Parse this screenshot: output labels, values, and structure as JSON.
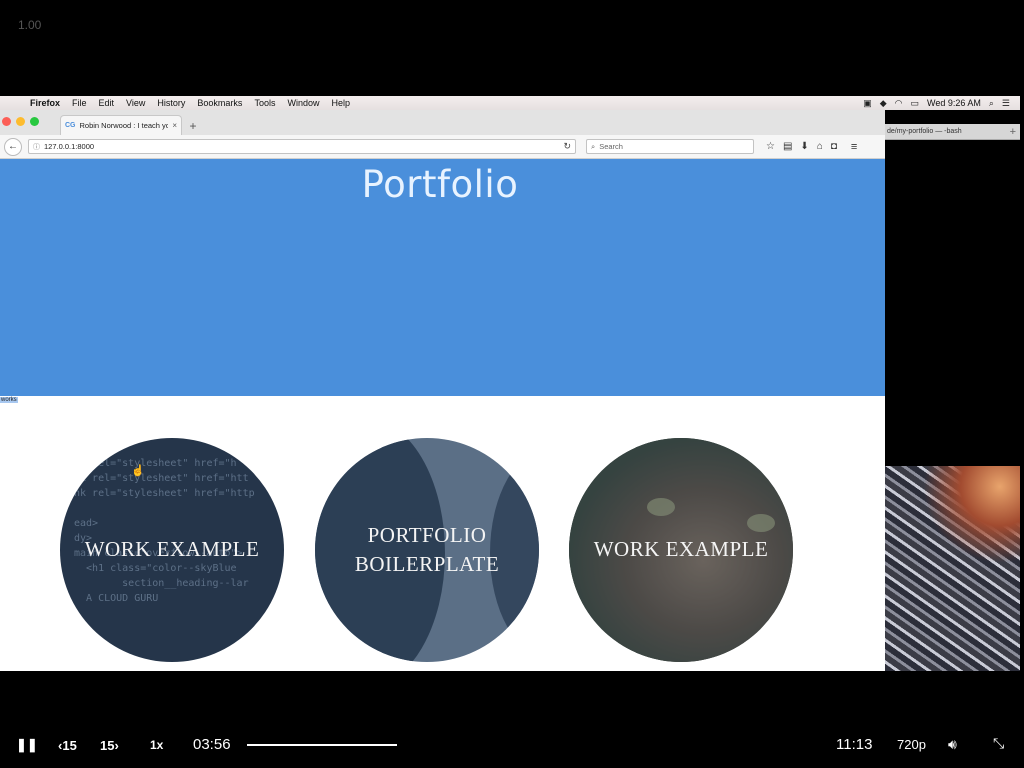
{
  "player": {
    "speed_readout": "1.00",
    "current_time": "03:56",
    "total_time": "11:13",
    "playback_rate": "1x",
    "quality": "720p",
    "back_label": "15",
    "forward_label": "15",
    "progress": 0.35
  },
  "menubar": {
    "app": "Firefox",
    "items": [
      "File",
      "Edit",
      "View",
      "History",
      "Bookmarks",
      "Tools",
      "Window",
      "Help"
    ],
    "clock": "Wed 9:26 AM"
  },
  "terminal_tab": {
    "title": "de/my-portfolio — -bash"
  },
  "browser": {
    "tab_title": "Robin Norwood : I teach you t",
    "favicon": "CG",
    "url": "127.0.0.1:8000",
    "search_placeholder": "Search"
  },
  "page": {
    "hero_title": "Portfolio",
    "selected_text": "works",
    "cards": [
      {
        "label": "WORK EXAMPLE"
      },
      {
        "label_line1": "PORTFOLIO",
        "label_line2": "BOILERPLATE"
      },
      {
        "label": "WORK EXAMPLE"
      }
    ],
    "code_lines": [
      "<  rel=\"stylesheet\" href=\"h",
      "nk rel=\"stylesheet\" href=\"htt",
      "nk rel=\"stylesheet\" href=\"http",
      "",
      "ead>",
      "dy>",
      "main class=\"overflow--auto\">",
      "  <h1 class=\"color--skyBlue",
      "        section__heading--lar",
      "  A CLOUD GURU"
    ]
  },
  "colors": {
    "hero_blue": "#4a8fdb",
    "hero_title": "#e8f3ff"
  }
}
